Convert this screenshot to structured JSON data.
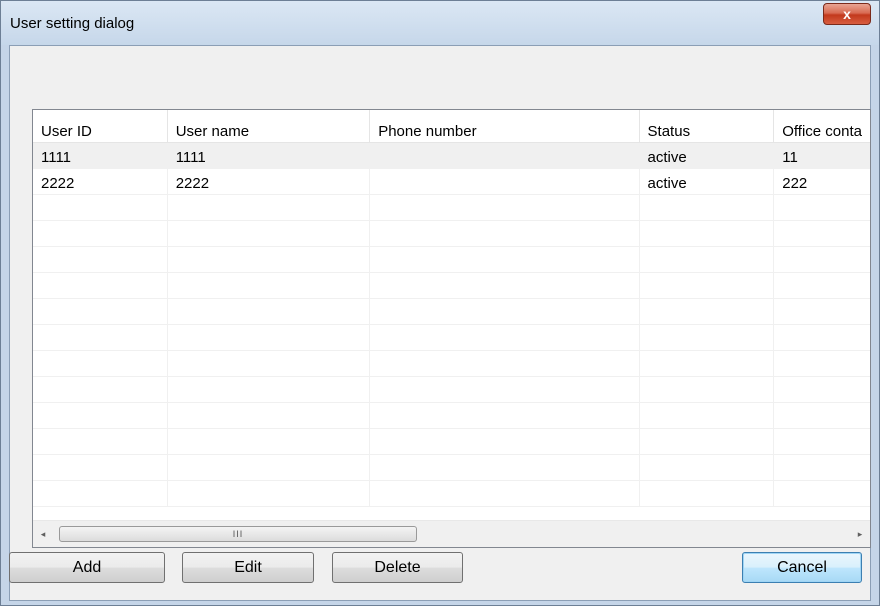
{
  "window": {
    "title": "User setting dialog",
    "close_glyph": "x"
  },
  "table": {
    "columns": [
      "User ID",
      "User name",
      "Phone number",
      "Status",
      "Office conta"
    ],
    "rows": [
      [
        "1111",
        "1111",
        "",
        "active",
        "11"
      ],
      [
        "2222",
        "2222",
        "",
        "active",
        "222"
      ]
    ],
    "empty_rows": 12
  },
  "scrollbar": {
    "left_arrow": "◂",
    "right_arrow": "▸",
    "thumb_grip": "III"
  },
  "buttons": {
    "add": "Add",
    "edit": "Edit",
    "delete": "Delete",
    "cancel": "Cancel"
  },
  "colors": {
    "accent_default_button": "#3c7fb1",
    "close_button": "#c2391c",
    "selected_row": "#f0f0f0"
  }
}
